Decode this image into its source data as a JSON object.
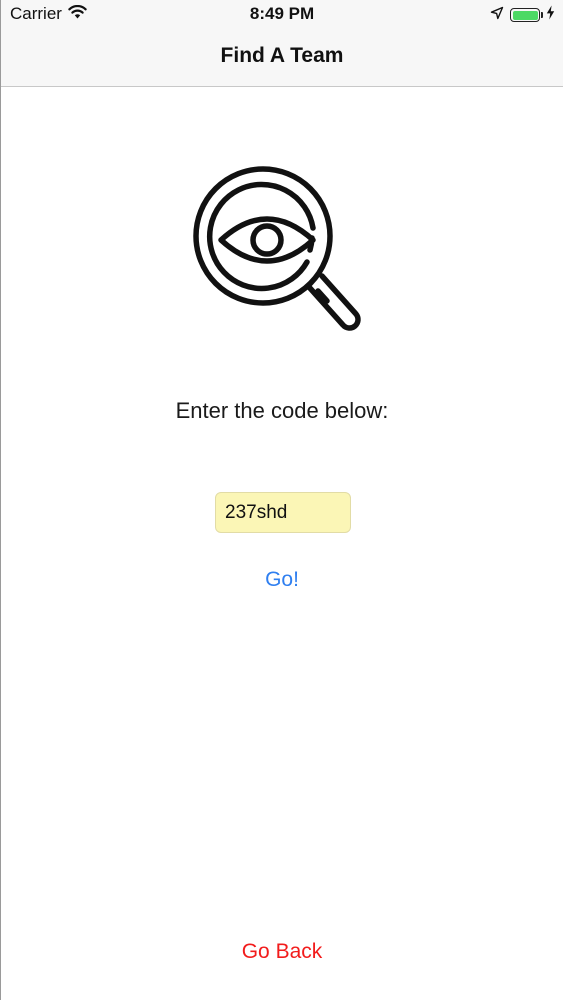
{
  "status_bar": {
    "carrier": "Carrier",
    "time": "8:49 PM",
    "icons": [
      "wifi-icon",
      "location-arrow-icon",
      "battery-icon",
      "charging-bolt-icon"
    ],
    "battery_level": 1.0,
    "battery_color": "#4cd964"
  },
  "nav": {
    "title": "Find A Team"
  },
  "main": {
    "hero_icon": "magnifier-eye-icon",
    "prompt": "Enter the code below:",
    "code_input": {
      "value": "237shd",
      "background": "#fbf6b6"
    },
    "go_label": "Go!",
    "go_color": "#2f7ff0"
  },
  "footer": {
    "back_label": "Go Back",
    "back_color": "#f21c1c"
  }
}
